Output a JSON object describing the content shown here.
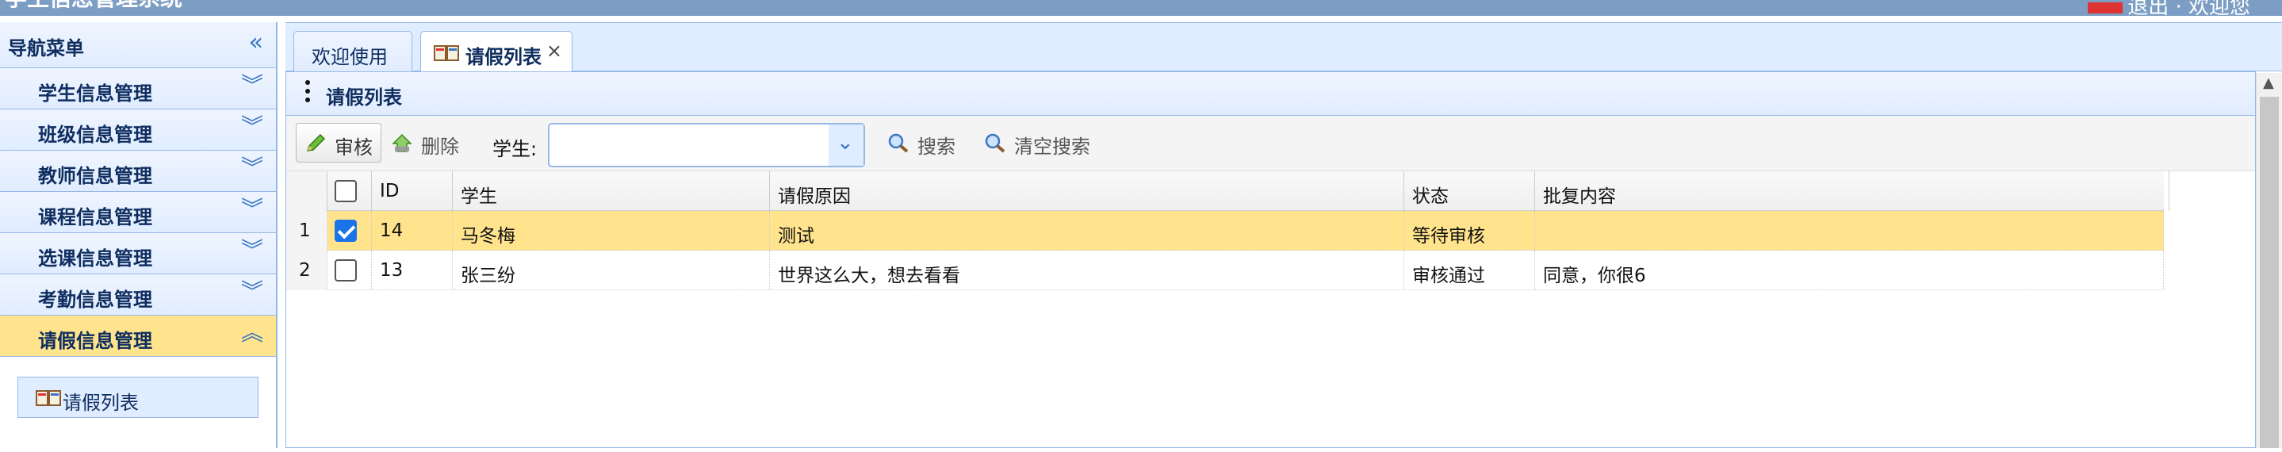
{
  "app": {
    "title": "学生信息管理系统",
    "user_text": "退出 · 欢迎您"
  },
  "sidebar": {
    "title": "导航菜单",
    "items": [
      {
        "label": "学生信息管理"
      },
      {
        "label": "班级信息管理"
      },
      {
        "label": "教师信息管理"
      },
      {
        "label": "课程信息管理"
      },
      {
        "label": "选课信息管理"
      },
      {
        "label": "考勤信息管理"
      },
      {
        "label": "请假信息管理",
        "active": true
      }
    ],
    "subitems": [
      {
        "label": "请假列表"
      }
    ]
  },
  "tabs": [
    {
      "label": "欢迎使用"
    },
    {
      "label": "请假列表",
      "selected": true
    }
  ],
  "panel": {
    "title": "请假列表"
  },
  "toolbar": {
    "approve_label": "审核",
    "delete_label": "删除",
    "student_label": "学生:",
    "student_value": "",
    "search_label": "搜索",
    "clear_label": "清空搜索"
  },
  "grid": {
    "headers": {
      "id": "ID",
      "student": "学生",
      "reason": "请假原因",
      "status": "状态",
      "reply": "批复内容"
    },
    "rows": [
      {
        "num": "1",
        "checked": true,
        "id": "14",
        "student": "马冬梅",
        "reason": "测试",
        "status": "等待审核",
        "reply": ""
      },
      {
        "num": "2",
        "checked": false,
        "id": "13",
        "student": "张三纷",
        "reason": "世界这么大，想去看看",
        "status": "审核通过",
        "reply": "同意，你很6"
      }
    ]
  },
  "colors": {
    "accent": "#95b8e7",
    "selected_row": "#ffe48d",
    "header_bg": "#e0ecff"
  }
}
